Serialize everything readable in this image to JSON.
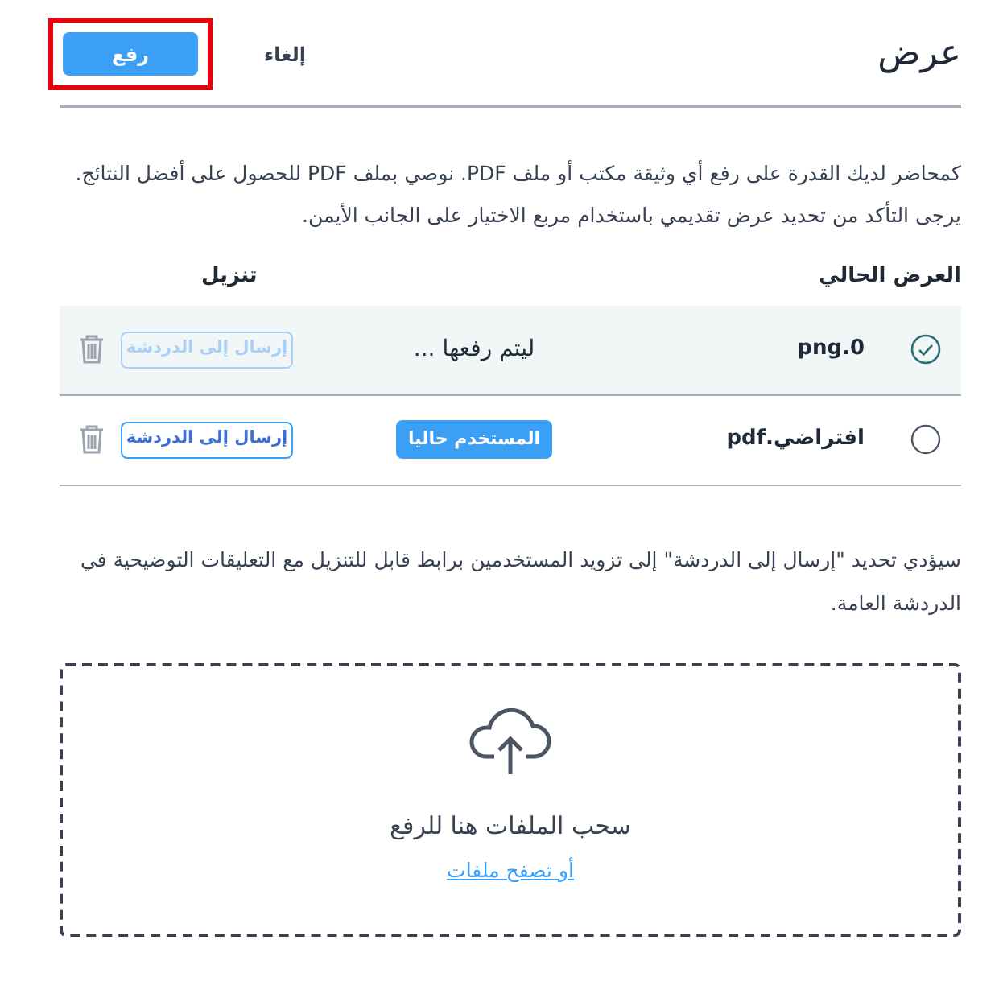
{
  "header": {
    "title": "عرض",
    "cancel": "إلغاء",
    "upload": {
      "label": "رفع",
      "highlighted": true
    }
  },
  "intro": "كمحاضر لديك القدرة على رفع أي وثيقة مكتب أو ملف PDF. نوصي بملف PDF للحصول على أفضل النتائج. يرجى التأكد من تحديد عرض تقديمي باستخدام مربع الاختيار على الجانب الأيمن.",
  "table": {
    "columns": [
      "العرض الحالي",
      "تنزيل"
    ],
    "rows": [
      {
        "name": "png.0",
        "selected": true,
        "status": {
          "kind": "pending",
          "text": "ليتم رفعها ..."
        },
        "send": {
          "label": "إرسال إلى الدردشة",
          "disabled": true
        }
      },
      {
        "name": "افتراضي.pdf",
        "selected": false,
        "status": {
          "kind": "badge",
          "text": "المستخدم حاليا"
        },
        "send": {
          "label": "إرسال إلى الدردشة",
          "disabled": false
        }
      }
    ]
  },
  "note": "سيؤدي تحديد \"إرسال إلى الدردشة\" إلى تزويد المستخدمين برابط قابل للتنزيل مع التعليقات التوضيحية في الدردشة العامة.",
  "dropzone": {
    "title": "سحب الملفات هنا للرفع",
    "link": "أو تصفح ملفات"
  }
}
